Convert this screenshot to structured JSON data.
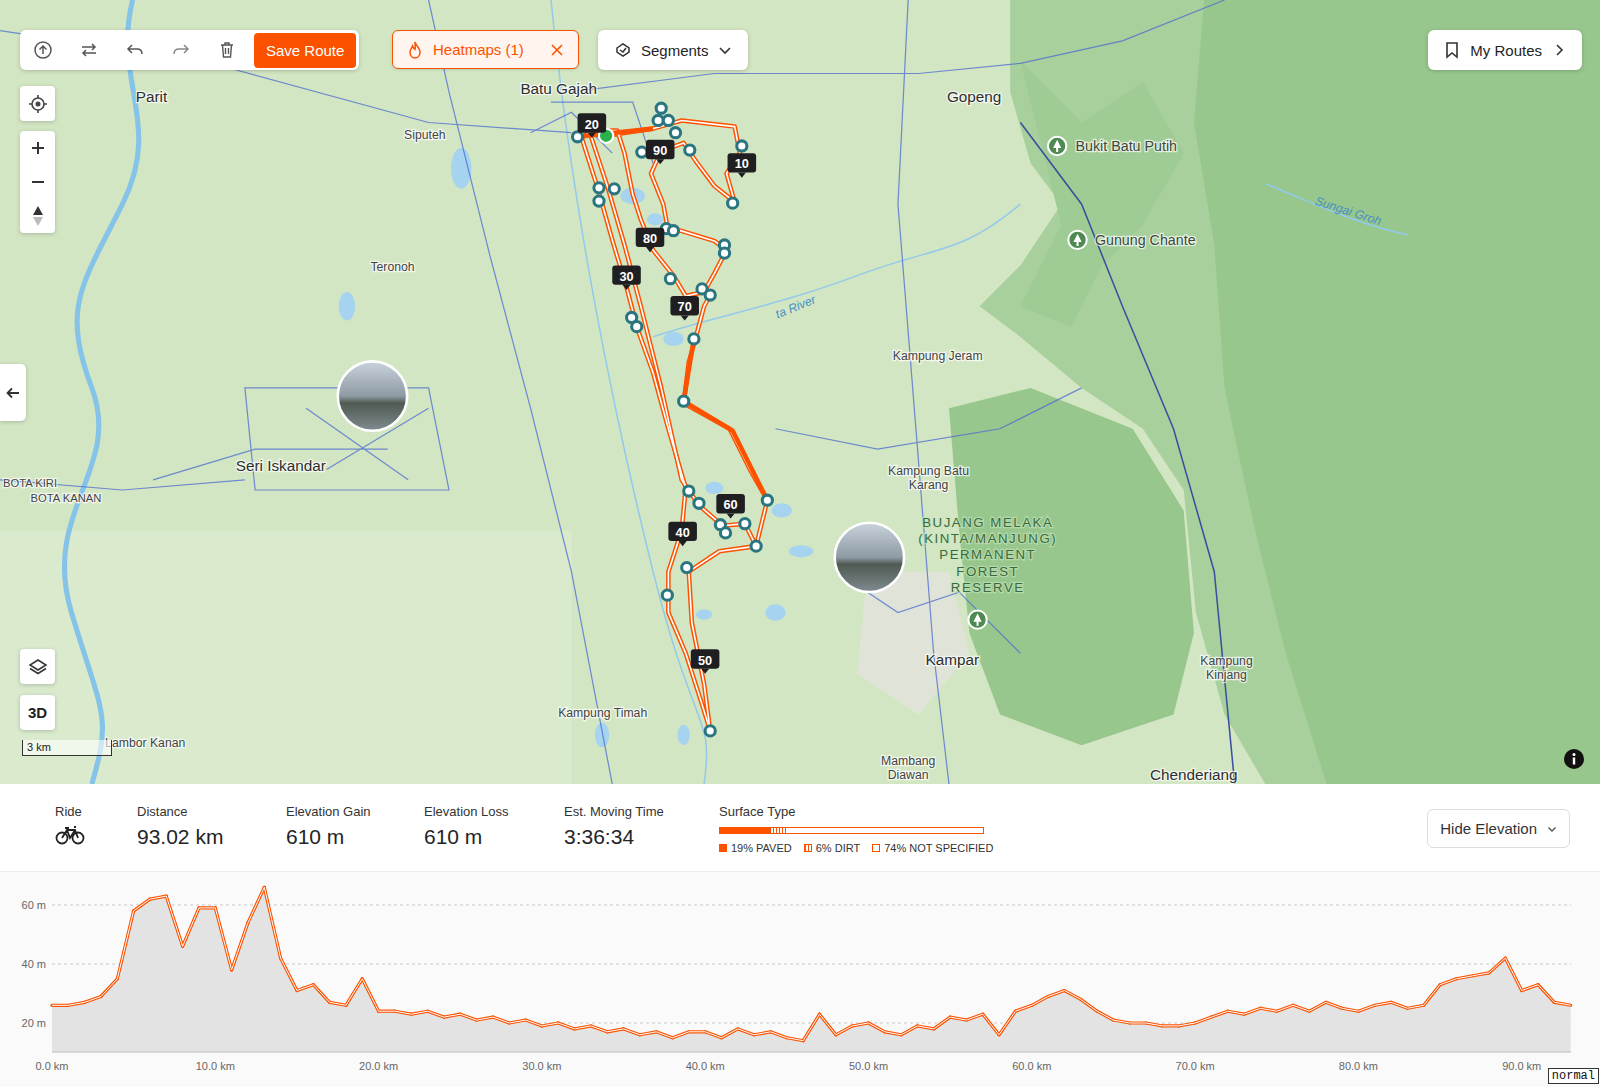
{
  "toolbar": {
    "save": "Save Route",
    "heatmaps": "Heatmaps (1)",
    "segments": "Segments",
    "my_routes": "My Routes"
  },
  "map_controls": {
    "three_d": "3D",
    "scale": "3 km"
  },
  "map": {
    "places": [
      {
        "lines": [
          "Parit"
        ],
        "kind": "town"
      },
      {
        "lines": [
          "Batu Gajah"
        ],
        "kind": "town"
      },
      {
        "lines": [
          "Gopeng"
        ],
        "kind": "town"
      },
      {
        "lines": [
          "Siputeh"
        ],
        "kind": "village"
      },
      {
        "lines": [
          "Bukit Batu Putih"
        ],
        "kind": "poi"
      },
      {
        "lines": [
          "Gunung Chante"
        ],
        "kind": "poi"
      },
      {
        "lines": [
          "Sungai Groh"
        ],
        "kind": "water"
      },
      {
        "lines": [
          "ta River"
        ],
        "kind": "water"
      },
      {
        "lines": [
          "Teronoh"
        ],
        "kind": "village"
      },
      {
        "lines": [
          "Kampung Jeram"
        ],
        "kind": "village"
      },
      {
        "lines": [
          "Seri Iskandar"
        ],
        "kind": "town"
      },
      {
        "lines": [
          "BOTA KIRI"
        ],
        "kind": "region"
      },
      {
        "lines": [
          "BOTA KANAN"
        ],
        "kind": "region"
      },
      {
        "lines": [
          "Kampung Batu",
          "Karang"
        ],
        "kind": "village"
      },
      {
        "lines": [
          "BUJANG MELAKA",
          "(KINTA/MANJUNG)",
          "PERMANENT",
          "FOREST",
          "RESERVE"
        ],
        "kind": "forest"
      },
      {
        "lines": [
          "Kampar"
        ],
        "kind": "town"
      },
      {
        "lines": [
          "Kampung",
          "Kinjang"
        ],
        "kind": "village"
      },
      {
        "lines": [
          "Kampung Timah"
        ],
        "kind": "village"
      },
      {
        "lines": [
          "Mambang",
          "Diawan"
        ],
        "kind": "village"
      },
      {
        "lines": [
          "Chenderiang"
        ],
        "kind": "town"
      },
      {
        "lines": [
          "Lambor Kanan"
        ],
        "kind": "village"
      }
    ],
    "km_markers": [
      "20",
      "90",
      "10",
      "80",
      "30",
      "70",
      "60",
      "40",
      "50"
    ]
  },
  "stats": {
    "activity": "Ride",
    "items": [
      {
        "label": "Distance",
        "value": "93.02 km"
      },
      {
        "label": "Elevation Gain",
        "value": "610 m"
      },
      {
        "label": "Elevation Loss",
        "value": "610 m"
      },
      {
        "label": "Est. Moving Time",
        "value": "3:36:34"
      }
    ],
    "surface": {
      "title": "Surface Type",
      "types": [
        {
          "label": "19% PAVED",
          "level": 0.19,
          "kind": "solid"
        },
        {
          "label": "6% DIRT",
          "level": 0.06,
          "kind": "hatched"
        },
        {
          "label": "74% NOT SPECIFIED",
          "level": 0.74,
          "kind": "outline"
        }
      ]
    },
    "toggle": "Hide Elevation"
  },
  "chart": {
    "y_ticks": [
      "60 m",
      "40 m",
      "20 m"
    ],
    "x_ticks": [
      "0.0 km",
      "10.0 km",
      "20.0 km",
      "30.0 km",
      "40.0 km",
      "50.0 km",
      "60.0 km",
      "70.0 km",
      "80.0 km",
      "90.0 km"
    ],
    "series": [
      {
        "name": "elevation",
        "values": [
          26,
          26,
          27,
          29,
          35,
          58,
          62,
          63,
          46,
          59,
          59,
          38,
          54,
          66,
          42,
          31,
          33,
          27,
          26,
          35,
          24,
          24,
          23,
          24,
          22,
          23,
          21,
          22,
          20,
          21,
          19,
          20,
          18,
          19,
          17,
          18,
          16,
          17,
          15,
          17,
          17,
          15,
          18,
          16,
          17,
          15,
          14,
          23,
          16,
          19,
          20,
          17,
          16,
          19,
          18,
          22,
          21,
          23,
          16,
          24,
          26,
          29,
          31,
          28,
          24,
          21,
          20,
          20,
          19,
          19,
          20,
          22,
          24,
          23,
          25,
          24,
          26,
          24,
          27,
          25,
          24,
          26,
          27,
          25,
          26,
          33,
          35,
          36,
          37,
          42,
          31,
          33,
          27,
          26
        ]
      }
    ]
  },
  "overlay_tag": "normal"
}
